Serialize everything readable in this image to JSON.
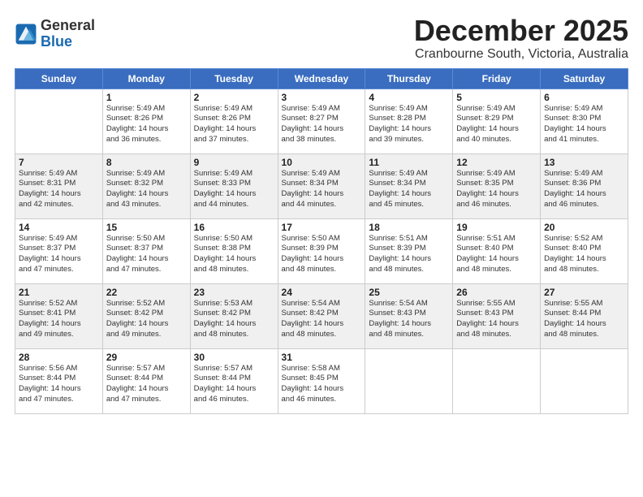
{
  "logo": {
    "general": "General",
    "blue": "Blue"
  },
  "header": {
    "month": "December 2025",
    "location": "Cranbourne South, Victoria, Australia"
  },
  "weekdays": [
    "Sunday",
    "Monday",
    "Tuesday",
    "Wednesday",
    "Thursday",
    "Friday",
    "Saturday"
  ],
  "weeks": [
    [
      {
        "day": "",
        "info": ""
      },
      {
        "day": "1",
        "info": "Sunrise: 5:49 AM\nSunset: 8:26 PM\nDaylight: 14 hours\nand 36 minutes."
      },
      {
        "day": "2",
        "info": "Sunrise: 5:49 AM\nSunset: 8:26 PM\nDaylight: 14 hours\nand 37 minutes."
      },
      {
        "day": "3",
        "info": "Sunrise: 5:49 AM\nSunset: 8:27 PM\nDaylight: 14 hours\nand 38 minutes."
      },
      {
        "day": "4",
        "info": "Sunrise: 5:49 AM\nSunset: 8:28 PM\nDaylight: 14 hours\nand 39 minutes."
      },
      {
        "day": "5",
        "info": "Sunrise: 5:49 AM\nSunset: 8:29 PM\nDaylight: 14 hours\nand 40 minutes."
      },
      {
        "day": "6",
        "info": "Sunrise: 5:49 AM\nSunset: 8:30 PM\nDaylight: 14 hours\nand 41 minutes."
      }
    ],
    [
      {
        "day": "7",
        "info": "Sunrise: 5:49 AM\nSunset: 8:31 PM\nDaylight: 14 hours\nand 42 minutes."
      },
      {
        "day": "8",
        "info": "Sunrise: 5:49 AM\nSunset: 8:32 PM\nDaylight: 14 hours\nand 43 minutes."
      },
      {
        "day": "9",
        "info": "Sunrise: 5:49 AM\nSunset: 8:33 PM\nDaylight: 14 hours\nand 44 minutes."
      },
      {
        "day": "10",
        "info": "Sunrise: 5:49 AM\nSunset: 8:34 PM\nDaylight: 14 hours\nand 44 minutes."
      },
      {
        "day": "11",
        "info": "Sunrise: 5:49 AM\nSunset: 8:34 PM\nDaylight: 14 hours\nand 45 minutes."
      },
      {
        "day": "12",
        "info": "Sunrise: 5:49 AM\nSunset: 8:35 PM\nDaylight: 14 hours\nand 46 minutes."
      },
      {
        "day": "13",
        "info": "Sunrise: 5:49 AM\nSunset: 8:36 PM\nDaylight: 14 hours\nand 46 minutes."
      }
    ],
    [
      {
        "day": "14",
        "info": "Sunrise: 5:49 AM\nSunset: 8:37 PM\nDaylight: 14 hours\nand 47 minutes."
      },
      {
        "day": "15",
        "info": "Sunrise: 5:50 AM\nSunset: 8:37 PM\nDaylight: 14 hours\nand 47 minutes."
      },
      {
        "day": "16",
        "info": "Sunrise: 5:50 AM\nSunset: 8:38 PM\nDaylight: 14 hours\nand 48 minutes."
      },
      {
        "day": "17",
        "info": "Sunrise: 5:50 AM\nSunset: 8:39 PM\nDaylight: 14 hours\nand 48 minutes."
      },
      {
        "day": "18",
        "info": "Sunrise: 5:51 AM\nSunset: 8:39 PM\nDaylight: 14 hours\nand 48 minutes."
      },
      {
        "day": "19",
        "info": "Sunrise: 5:51 AM\nSunset: 8:40 PM\nDaylight: 14 hours\nand 48 minutes."
      },
      {
        "day": "20",
        "info": "Sunrise: 5:52 AM\nSunset: 8:40 PM\nDaylight: 14 hours\nand 48 minutes."
      }
    ],
    [
      {
        "day": "21",
        "info": "Sunrise: 5:52 AM\nSunset: 8:41 PM\nDaylight: 14 hours\nand 49 minutes."
      },
      {
        "day": "22",
        "info": "Sunrise: 5:52 AM\nSunset: 8:42 PM\nDaylight: 14 hours\nand 49 minutes."
      },
      {
        "day": "23",
        "info": "Sunrise: 5:53 AM\nSunset: 8:42 PM\nDaylight: 14 hours\nand 48 minutes."
      },
      {
        "day": "24",
        "info": "Sunrise: 5:54 AM\nSunset: 8:42 PM\nDaylight: 14 hours\nand 48 minutes."
      },
      {
        "day": "25",
        "info": "Sunrise: 5:54 AM\nSunset: 8:43 PM\nDaylight: 14 hours\nand 48 minutes."
      },
      {
        "day": "26",
        "info": "Sunrise: 5:55 AM\nSunset: 8:43 PM\nDaylight: 14 hours\nand 48 minutes."
      },
      {
        "day": "27",
        "info": "Sunrise: 5:55 AM\nSunset: 8:44 PM\nDaylight: 14 hours\nand 48 minutes."
      }
    ],
    [
      {
        "day": "28",
        "info": "Sunrise: 5:56 AM\nSunset: 8:44 PM\nDaylight: 14 hours\nand 47 minutes."
      },
      {
        "day": "29",
        "info": "Sunrise: 5:57 AM\nSunset: 8:44 PM\nDaylight: 14 hours\nand 47 minutes."
      },
      {
        "day": "30",
        "info": "Sunrise: 5:57 AM\nSunset: 8:44 PM\nDaylight: 14 hours\nand 46 minutes."
      },
      {
        "day": "31",
        "info": "Sunrise: 5:58 AM\nSunset: 8:45 PM\nDaylight: 14 hours\nand 46 minutes."
      },
      {
        "day": "",
        "info": ""
      },
      {
        "day": "",
        "info": ""
      },
      {
        "day": "",
        "info": ""
      }
    ]
  ]
}
